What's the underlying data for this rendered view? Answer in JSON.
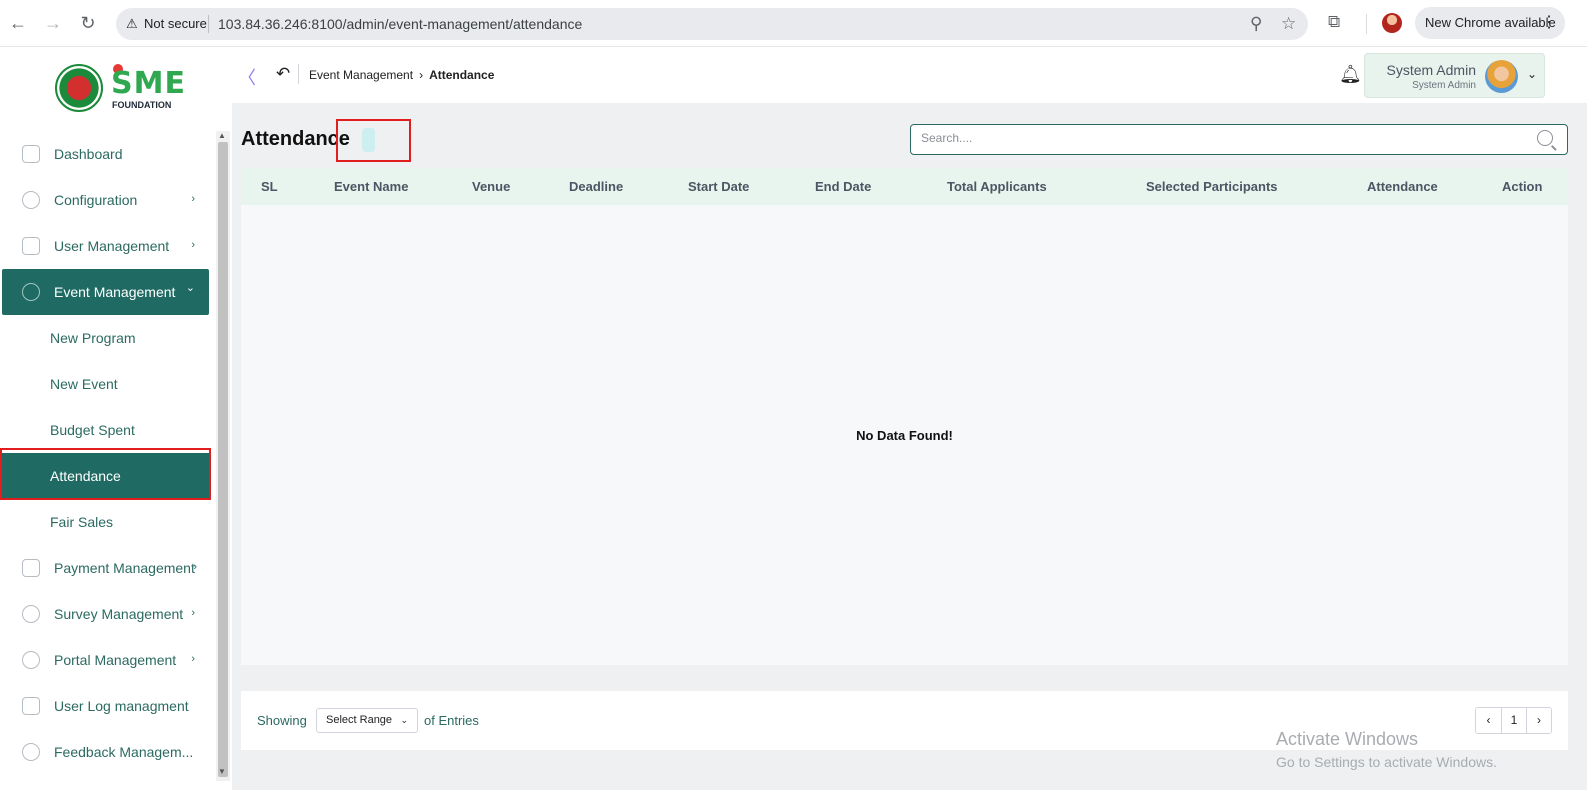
{
  "browser": {
    "back_icon": "←",
    "forward_icon": "→",
    "reload_icon": "↻",
    "warning_icon": "⚠",
    "security_label": "Not secure",
    "url": "103.84.36.246:8100/admin/event-management/attendance",
    "zoom_icon": "⚲",
    "star_icon": "☆",
    "extensions_icon": "⧉",
    "update_label": "New Chrome available",
    "menu_icon": "⋮"
  },
  "logo": {
    "text": "SME",
    "subtitle": "FOUNDATION"
  },
  "sidebar": {
    "items": [
      {
        "label": "Dashboard",
        "icon": "grid-icon"
      },
      {
        "label": "Configuration",
        "icon": "config-icon",
        "chevron": "›"
      },
      {
        "label": "User Management",
        "icon": "shield-icon",
        "chevron": "›"
      },
      {
        "label": "Event Management",
        "icon": "lock-icon",
        "chevron": "⌄"
      }
    ],
    "sub_items": [
      "New Program",
      "New Event",
      "Budget Spent",
      "Attendance",
      "Fair Sales"
    ],
    "more_items": [
      {
        "label": "Payment Management",
        "icon": "payment-icon",
        "chevron": "›"
      },
      {
        "label": "Survey Management",
        "icon": "pie-icon",
        "chevron": "›"
      },
      {
        "label": "Portal Management",
        "icon": "lock-icon",
        "chevron": "›"
      },
      {
        "label": "User Log managment",
        "icon": "log-icon"
      },
      {
        "label": "Feedback Managem...",
        "icon": "feedback-icon"
      }
    ],
    "scroll_up": "▲",
    "scroll_down": "▼"
  },
  "header": {
    "collapse_icon": "〈",
    "back_icon": "↶",
    "breadcrumb": {
      "parent": "Event Management",
      "separator": "›",
      "current": "Attendance"
    },
    "bell_icon": "🔔︎",
    "user": {
      "name": "System Admin",
      "role": "System Admin",
      "chevron": "⌄"
    }
  },
  "page": {
    "title": "Attendance",
    "search_placeholder": "Search...."
  },
  "table": {
    "columns": [
      "SL",
      "Event Name",
      "Venue",
      "Deadline",
      "Start Date",
      "End Date",
      "Total Applicants",
      "Selected Participants",
      "Attendance",
      "Action"
    ],
    "rows": [],
    "empty_message": "No Data Found!"
  },
  "footer": {
    "showing_label": "Showing",
    "range_label": "Select Range",
    "range_chevron": "⌄",
    "entries_label": "of Entries",
    "prev_icon": "‹",
    "page": "1",
    "next_icon": "›"
  },
  "watermark": {
    "line1": "Activate Windows",
    "line2": "Go to Settings to activate Windows."
  },
  "colors": {
    "accent": "#1f6b63",
    "table_header_bg": "#e8f5ee",
    "highlight": "#e11d1d"
  }
}
